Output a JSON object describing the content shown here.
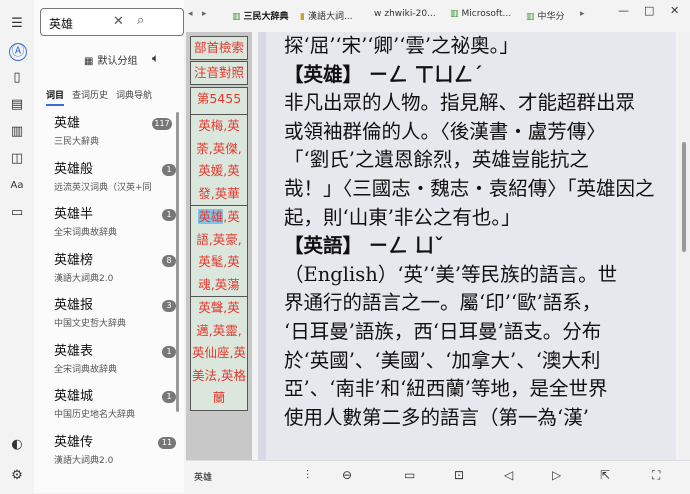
{
  "search": {
    "query": "英雄"
  },
  "panel": {
    "group_label": "默认分组",
    "tabs": [
      "词目",
      "查词历史",
      "词典导航"
    ],
    "items": [
      {
        "term": "英雄",
        "source": "三民大辭典",
        "count": "117"
      },
      {
        "term": "英雄般",
        "source": "远流英汉词典（汉英+同",
        "count": "1"
      },
      {
        "term": "英雄半",
        "source": "全宋词典故辞典",
        "count": "1"
      },
      {
        "term": "英雄榜",
        "source": "漢語大詞典2.0",
        "count": "8"
      },
      {
        "term": "英雄报",
        "source": "中国文史哲大辞典",
        "count": "3"
      },
      {
        "term": "英雄表",
        "source": "全宋词典故辞典",
        "count": "1"
      },
      {
        "term": "英雄城",
        "source": "中国历史地名大辞典",
        "count": "1"
      },
      {
        "term": "英雄传",
        "source": "漢語大詞典2.0",
        "count": "11"
      }
    ]
  },
  "index_buttons": {
    "radical": "部首檢索",
    "phonetic": "注音對照",
    "page": "第5455页",
    "group1": [
      "英梅,英",
      "荼,英傑,",
      "英媛,英",
      "發,英華"
    ],
    "group2_hl": "英雄",
    "group2_first_rest": ",英",
    "group2": [
      "語,英豪,",
      "英髦,英",
      "魂,英蕩"
    ],
    "group3": [
      "英聲,英",
      "邁,英靈,",
      "英仙座,英",
      "美法,英格",
      "蘭"
    ]
  },
  "tabs": [
    "三民大辞典",
    "漢語大詞...",
    "zhwiki-20...",
    "Microsoft...",
    "中华分"
  ],
  "content": {
    "lines": [
      "探‘屈’‘宋’‘卿’‘雲’之祕奧。」",
      "【英雄】 ㄧㄥ ㄒㄩㄥˊ",
      "非凡出眾的人物。指見解、才能超群出眾",
      "或領袖群倫的人。〈後漢書・盧芳傳〉",
      "「‘劉氏’之遺恩餘烈，英雄豈能抗之",
      "哉！」〈三國志・魏志・袁紹傳〉「英雄因之",
      "起，則‘山東’非公之有也。」",
      "【英語】 ㄧㄥ ㄩˇ",
      "（English）‘英’‘美’等民族的語言。世",
      "界通行的語言之一。屬‘印’‘歐’語系，",
      "‘日耳曼’語族，西‘日耳曼’語支。分布",
      "於‘英國’、‘美國’、‘加拿大’、‘澳大利",
      "亞’、‘南非’和‘紐西蘭’等地，是全世界",
      "使用人數第二多的語言（第一為‘漢’"
    ]
  },
  "bottom": {
    "word": "英雄"
  }
}
